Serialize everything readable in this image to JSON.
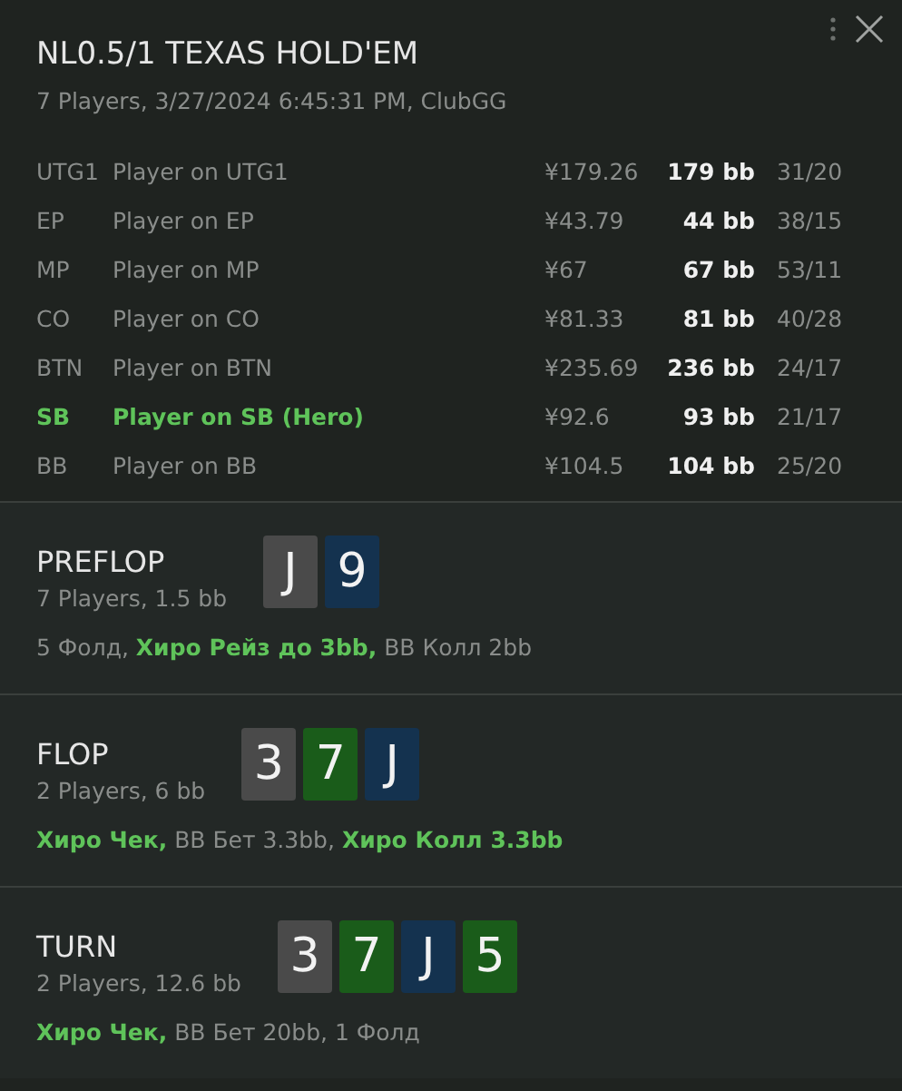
{
  "header": {
    "title": "NL0.5/1 TEXAS HOLD'EM",
    "subtitle": "7 Players, 3/27/2024 6:45:31 PM, ClubGG"
  },
  "players": [
    {
      "position": "UTG1",
      "name": "Player on UTG1",
      "stack": "¥179.26",
      "bb": "179 bb",
      "stats": "31/20",
      "hero": false
    },
    {
      "position": "EP",
      "name": "Player on EP",
      "stack": "¥43.79",
      "bb": "44 bb",
      "stats": "38/15",
      "hero": false
    },
    {
      "position": "MP",
      "name": "Player on MP",
      "stack": "¥67",
      "bb": "67 bb",
      "stats": "53/11",
      "hero": false
    },
    {
      "position": "CO",
      "name": "Player on CO",
      "stack": "¥81.33",
      "bb": "81 bb",
      "stats": "40/28",
      "hero": false
    },
    {
      "position": "BTN",
      "name": "Player on BTN",
      "stack": "¥235.69",
      "bb": "236 bb",
      "stats": "24/17",
      "hero": false
    },
    {
      "position": "SB",
      "name": "Player on SB (Hero)",
      "stack": "¥92.6",
      "bb": "93 bb",
      "stats": "21/17",
      "hero": true
    },
    {
      "position": "BB",
      "name": "Player on BB",
      "stack": "¥104.5",
      "bb": "104 bb",
      "stats": "25/20",
      "hero": false
    }
  ],
  "streets": [
    {
      "name": "PREFLOP",
      "info": "7 Players, 1.5 bb",
      "cards": [
        {
          "rank": "J",
          "color": "#4a4a4a"
        },
        {
          "rank": "9",
          "color": "#14324f"
        }
      ],
      "actions": [
        {
          "text": "5 Фолд, ",
          "hero": false
        },
        {
          "text": "Хиро Рейз до 3bb,",
          "hero": true
        },
        {
          "text": " BB Колл 2bb",
          "hero": false
        }
      ]
    },
    {
      "name": "FLOP",
      "info": "2 Players, 6 bb",
      "cards": [
        {
          "rank": "3",
          "color": "#4a4a4a"
        },
        {
          "rank": "7",
          "color": "#1a5c1a"
        },
        {
          "rank": "J",
          "color": "#14324f"
        }
      ],
      "actions": [
        {
          "text": "Хиро Чек,",
          "hero": true
        },
        {
          "text": " BB Бет 3.3bb, ",
          "hero": false
        },
        {
          "text": "Хиро Колл 3.3bb",
          "hero": true
        }
      ]
    },
    {
      "name": "TURN",
      "info": "2 Players, 12.6 bb",
      "cards": [
        {
          "rank": "3",
          "color": "#4a4a4a"
        },
        {
          "rank": "7",
          "color": "#1a5c1a"
        },
        {
          "rank": "J",
          "color": "#14324f"
        },
        {
          "rank": "5",
          "color": "#1a5c1a"
        }
      ],
      "actions": [
        {
          "text": "Хиро Чек,",
          "hero": true
        },
        {
          "text": " BB Бет 20bb, 1 Фолд",
          "hero": false
        }
      ]
    }
  ]
}
